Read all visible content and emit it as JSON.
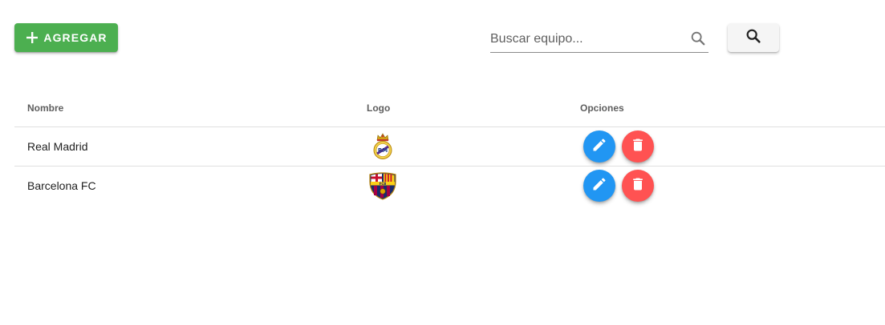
{
  "toolbar": {
    "add_label": "AGREGAR",
    "search_placeholder": "Buscar equipo...",
    "search_value": ""
  },
  "table": {
    "headers": {
      "name": "Nombre",
      "logo": "Logo",
      "options": "Opciones"
    },
    "rows": [
      {
        "name": "Real Madrid",
        "logo_icon": "real-madrid-crest-icon"
      },
      {
        "name": "Barcelona FC",
        "logo_icon": "fc-barcelona-crest-icon"
      }
    ]
  },
  "icons": {
    "add": "plus-icon",
    "search": "search-icon",
    "edit": "pencil-icon",
    "delete": "trash-icon"
  },
  "colors": {
    "add_button": "#4caf50",
    "edit_button": "#2196f3",
    "delete_button": "#ff5252",
    "search_button": "#f5f5f5"
  }
}
